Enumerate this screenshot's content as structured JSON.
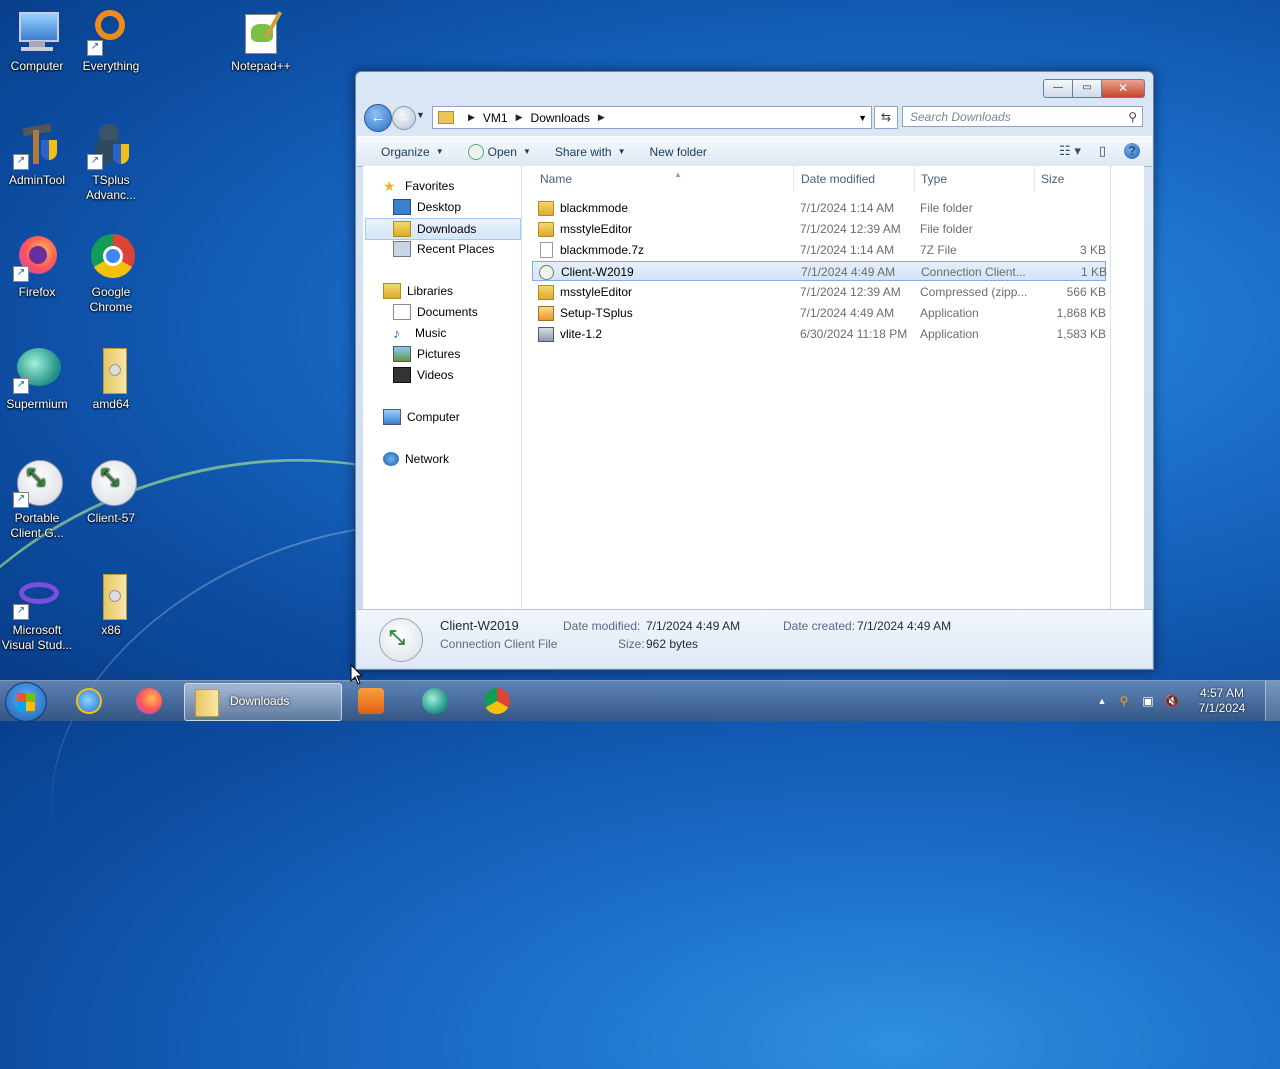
{
  "desktop": {
    "icons": [
      {
        "label": "Computer"
      },
      {
        "label": "Everything"
      },
      {
        "label": "Notepad++"
      },
      {
        "label": "AdminTool"
      },
      {
        "label": "TSplus Advanc..."
      },
      {
        "label": "Firefox"
      },
      {
        "label": "Google Chrome"
      },
      {
        "label": "Supermium"
      },
      {
        "label": "amd64"
      },
      {
        "label": "Portable Client G..."
      },
      {
        "label": "Client-57"
      },
      {
        "label": "Microsoft Visual Stud..."
      },
      {
        "label": "x86"
      }
    ]
  },
  "window": {
    "caption_buttons": {
      "minimize": "—",
      "maximize": "▭",
      "close": "✕"
    },
    "address": {
      "segments": [
        "VM1",
        "Downloads"
      ]
    },
    "search": {
      "placeholder": "Search Downloads"
    },
    "commands": {
      "organize": "Organize",
      "open": "Open",
      "share_with": "Share with",
      "new_folder": "New folder"
    },
    "nav": {
      "favorites": "Favorites",
      "desktop": "Desktop",
      "downloads": "Downloads",
      "recent_places": "Recent Places",
      "libraries": "Libraries",
      "documents": "Documents",
      "music": "Music",
      "pictures": "Pictures",
      "videos": "Videos",
      "computer": "Computer",
      "network": "Network"
    },
    "columns": {
      "name": "Name",
      "date_modified": "Date modified",
      "type": "Type",
      "size": "Size"
    },
    "files": [
      {
        "name": "blackmmode",
        "date": "7/1/2024 1:14 AM",
        "type": "File folder",
        "size": "",
        "icon": "folder-icon"
      },
      {
        "name": "msstyleEditor",
        "date": "7/1/2024 12:39 AM",
        "type": "File folder",
        "size": "",
        "icon": "folder-icon"
      },
      {
        "name": "blackmmode.7z",
        "date": "7/1/2024 1:14 AM",
        "type": "7Z File",
        "size": "3 KB",
        "icon": "file-icon"
      },
      {
        "name": "Client-W2019",
        "date": "7/1/2024 4:49 AM",
        "type": "Connection Client...",
        "size": "1 KB",
        "icon": "connection-icon"
      },
      {
        "name": "msstyleEditor",
        "date": "7/1/2024 12:39 AM",
        "type": "Compressed (zipp...",
        "size": "566 KB",
        "icon": "zip-icon"
      },
      {
        "name": "Setup-TSplus",
        "date": "7/1/2024 4:49 AM",
        "type": "Application",
        "size": "1,868 KB",
        "icon": "installer-icon"
      },
      {
        "name": "vlite-1.2",
        "date": "6/30/2024 11:18 PM",
        "type": "Application",
        "size": "1,583 KB",
        "icon": "application-icon"
      }
    ],
    "details": {
      "name": "Client-W2019",
      "type": "Connection Client File",
      "date_modified_label": "Date modified:",
      "date_modified": "7/1/2024 4:49 AM",
      "date_created_label": "Date created:",
      "date_created": "7/1/2024 4:49 AM",
      "size_label": "Size:",
      "size": "962 bytes"
    }
  },
  "taskbar": {
    "active_label": "Downloads",
    "clock_time": "4:57 AM",
    "clock_date": "7/1/2024"
  }
}
